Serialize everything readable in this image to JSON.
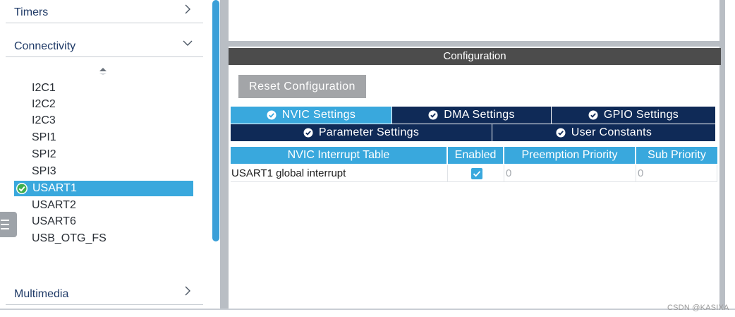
{
  "sidebar": {
    "categories": {
      "timers": "Timers",
      "connectivity": "Connectivity",
      "multimedia": "Multimedia"
    },
    "items": [
      "I2C1",
      "I2C2",
      "I2C3",
      "SPI1",
      "SPI2",
      "SPI3",
      "USART1",
      "USART2",
      "USART6",
      "USB_OTG_FS"
    ],
    "selected_item": "USART1"
  },
  "config": {
    "title": "Configuration",
    "reset_label": "Reset Configuration",
    "tabs": {
      "nvic": "NVIC Settings",
      "dma": "DMA Settings",
      "gpio": "GPIO Settings",
      "parameter": "Parameter Settings",
      "user_constants": "User Constants"
    },
    "active_tab": "NVIC Settings",
    "table": {
      "headers": {
        "name": "NVIC Interrupt Table",
        "enabled": "Enabled",
        "preemption": "Preemption Priority",
        "sub": "Sub Priority"
      },
      "rows": [
        {
          "name": "USART1 global interrupt",
          "enabled": true,
          "preemption": "0",
          "sub": "0"
        }
      ]
    }
  },
  "watermark": "CSDN @KASIXA",
  "colors": {
    "accent": "#39a8dd",
    "tab_dark": "#0f2a57",
    "title_bar": "#4c4c4c",
    "reset_button": "#a3a5a8",
    "gutter": "#b9bec4"
  }
}
